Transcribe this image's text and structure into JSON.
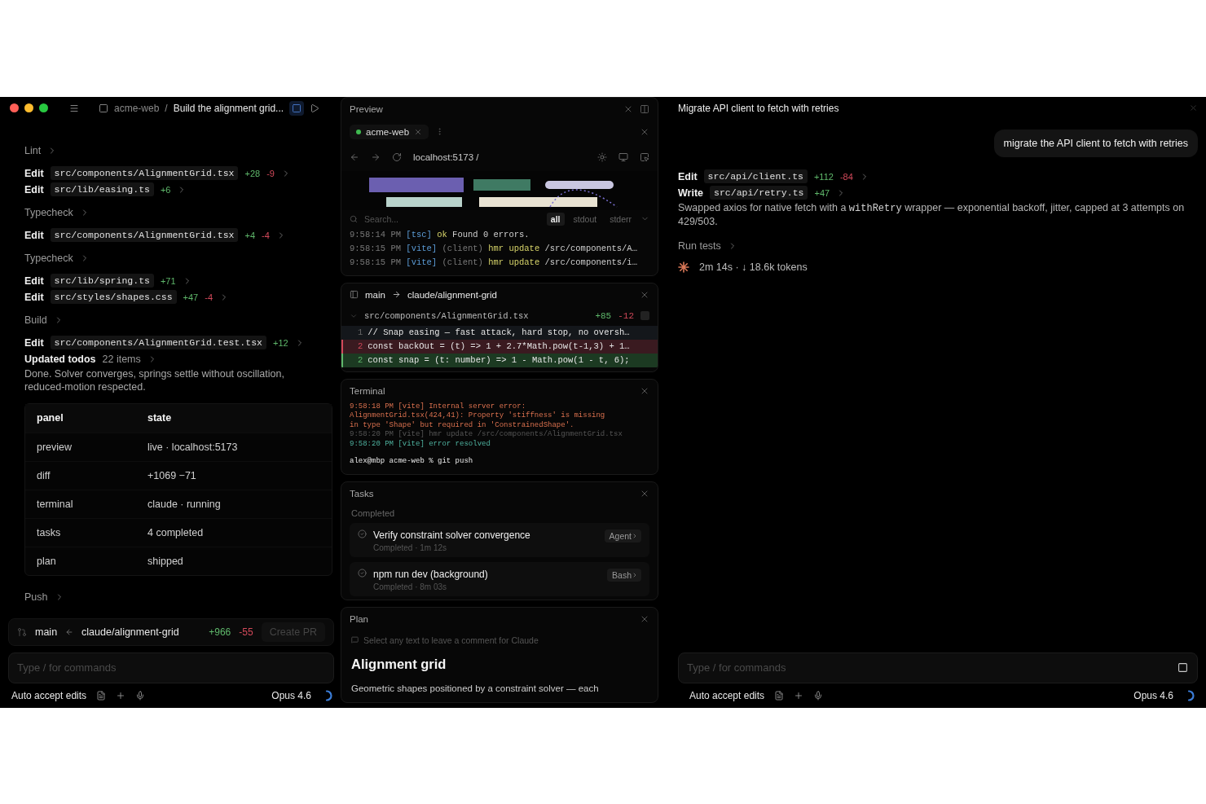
{
  "left": {
    "project": "acme-web",
    "separator": "/",
    "title": "Build the alignment grid...",
    "items": [
      {
        "kind": "step",
        "label": "Lint"
      },
      {
        "kind": "edit",
        "verb": "Edit",
        "file": "src/components/AlignmentGrid.tsx",
        "added": "+28",
        "removed": "-9"
      },
      {
        "kind": "edit",
        "verb": "Edit",
        "file": "src/lib/easing.ts",
        "added": "+6"
      },
      {
        "kind": "step",
        "label": "Typecheck"
      },
      {
        "kind": "edit",
        "verb": "Edit",
        "file": "src/components/AlignmentGrid.tsx",
        "added": "+4",
        "removed": "-4"
      },
      {
        "kind": "step",
        "label": "Typecheck"
      },
      {
        "kind": "edit",
        "verb": "Edit",
        "file": "src/lib/spring.ts",
        "added": "+71"
      },
      {
        "kind": "edit",
        "verb": "Edit",
        "file": "src/styles/shapes.css",
        "added": "+47",
        "removed": "-4"
      },
      {
        "kind": "step",
        "label": "Build"
      },
      {
        "kind": "edit",
        "verb": "Edit",
        "file": "src/components/AlignmentGrid.test.tsx",
        "added": "+12"
      },
      {
        "kind": "todos",
        "label": "Updated todos",
        "count": "22 items"
      },
      {
        "kind": "text",
        "text": "Done. Solver converges, springs settle without oscillation, reduced-motion respected."
      },
      {
        "kind": "table",
        "columns": [
          "panel",
          "state"
        ],
        "rows": [
          [
            "preview",
            "live · localhost:5173"
          ],
          [
            "diff",
            "+1069 −71"
          ],
          [
            "terminal",
            "claude · running"
          ],
          [
            "tasks",
            "4 completed"
          ],
          [
            "plan",
            "shipped"
          ]
        ]
      },
      {
        "kind": "step",
        "label": "Push"
      }
    ],
    "branch": {
      "base": "main",
      "head": "claude/alignment-grid",
      "added": "+966",
      "removed": "-55",
      "button": "Create PR"
    },
    "input": {
      "placeholder": "Type / for commands"
    },
    "footer": {
      "mode": "Auto accept edits",
      "model": "Opus 4.6"
    }
  },
  "preview": {
    "title": "Preview",
    "tab": {
      "label": "acme-web",
      "color": "#3fb950"
    },
    "url": "localhost:5173 /",
    "search": {
      "placeholder": "Search..."
    },
    "filters": [
      {
        "label": "all",
        "selected": true
      },
      {
        "label": "stdout",
        "selected": false
      },
      {
        "label": "stderr",
        "selected": false
      }
    ],
    "logs": [
      [
        {
          "kind": "time",
          "text": "9:58:14 PM"
        },
        {
          "kind": "tag",
          "text": "[tsc]"
        },
        {
          "kind": "hl",
          "text": "ok"
        },
        {
          "kind": "plain",
          "text": "Found 0 errors."
        }
      ],
      [
        {
          "kind": "time",
          "text": "9:58:15 PM"
        },
        {
          "kind": "tag",
          "text": "[vite]"
        },
        {
          "kind": "dim",
          "text": "(client)"
        },
        {
          "kind": "hl",
          "text": "hmr update"
        },
        {
          "kind": "plain",
          "text": "/src/components/A…"
        }
      ],
      [
        {
          "kind": "time",
          "text": "9:58:15 PM"
        },
        {
          "kind": "tag",
          "text": "[vite]"
        },
        {
          "kind": "dim",
          "text": "(client)"
        },
        {
          "kind": "hl",
          "text": "hmr update"
        },
        {
          "kind": "plain",
          "text": "/src/components/i…"
        }
      ]
    ]
  },
  "diff": {
    "base": "main",
    "head": "claude/alignment-grid",
    "file": "src/components/AlignmentGrid.tsx",
    "added": "+85",
    "removed": "-12",
    "viewed": false,
    "lines": [
      {
        "kind": "context",
        "num": "1",
        "text": "// Snap easing — fast attack, hard stop, no oversh…"
      },
      {
        "kind": "del",
        "num": "2",
        "text": "const backOut = (t) => 1 + 2.7*Math.pow(t-1,3) + 1…"
      },
      {
        "kind": "add",
        "num": "2",
        "text": "const snap = (t: number) => 1 - Math.pow(1 - t, 6);"
      }
    ]
  },
  "terminal": {
    "title": "Terminal",
    "lines": [
      {
        "kind": "error",
        "text": "9:58:18 PM [vite] Internal server error:"
      },
      {
        "kind": "error",
        "text": "AlignmentGrid.tsx(424,41): Property 'stiffness' is missing"
      },
      {
        "kind": "error",
        "text": "in type 'Shape' but required in 'ConstrainedShape'."
      },
      {
        "kind": "dim",
        "text": "9:58:20 PM [vite] hmr update /src/components/AlignmentGrid.tsx"
      },
      {
        "kind": "success",
        "text": "9:58:20 PM [vite] error resolved"
      },
      {
        "kind": "prompt",
        "text": "alex@mbp acme-web % git push"
      }
    ]
  },
  "tasks": {
    "title": "Tasks",
    "section": "Completed",
    "items": [
      {
        "title": "Verify constraint solver convergence",
        "meta": "Completed · 1m 12s",
        "badge": "Agent"
      },
      {
        "title": "npm run dev (background)",
        "meta": "Completed · 8m 03s",
        "badge": "Bash"
      }
    ]
  },
  "plan": {
    "title": "Plan",
    "hint": "Select any text to leave a comment for Claude",
    "heading": "Alignment grid",
    "text": "Geometric shapes positioned by a constraint solver — each"
  },
  "right": {
    "title": "Migrate API client to fetch with retries",
    "message": "migrate the API client to fetch with retries",
    "edits": [
      {
        "verb": "Edit",
        "file": "src/api/client.ts",
        "added": "+112",
        "removed": "-84"
      },
      {
        "verb": "Write",
        "file": "src/api/retry.ts",
        "added": "+47"
      }
    ],
    "summary": [
      {
        "kind": "text",
        "text": "Swapped axios for native fetch with a "
      },
      {
        "kind": "code",
        "text": "withRetry"
      },
      {
        "kind": "text",
        "text": " wrapper — exponential backoff, jitter, capped at 3 attempts on 429/503."
      }
    ],
    "step": "Run tests",
    "status": "2m 14s · ↓ 18.6k tokens",
    "input": {
      "placeholder": "Type / for commands"
    },
    "footer": {
      "mode": "Auto accept edits",
      "model": "Opus 4.6"
    }
  }
}
